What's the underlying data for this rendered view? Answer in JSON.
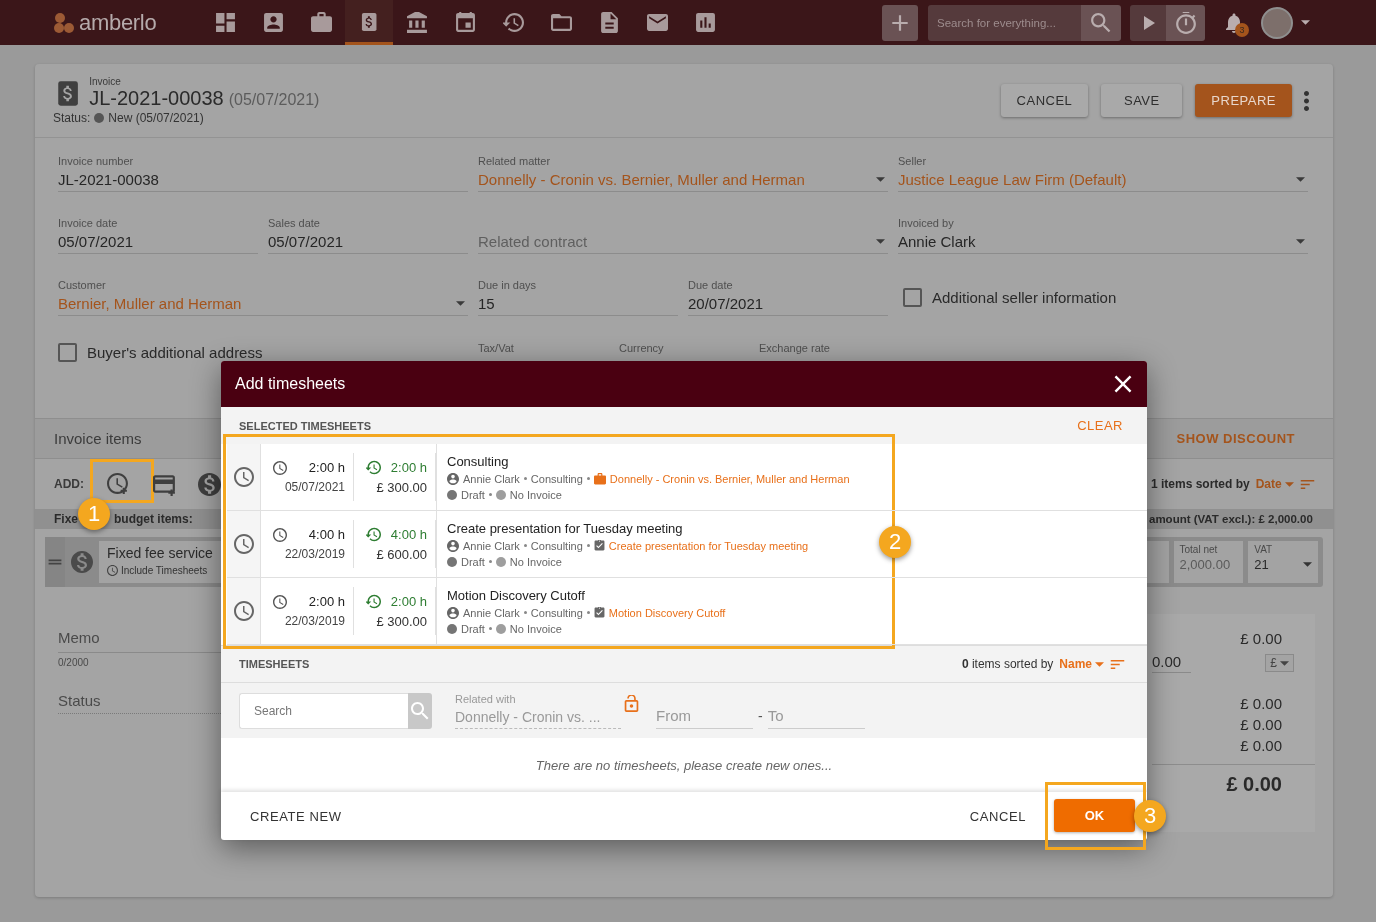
{
  "nav": {
    "logo": "amberlo",
    "items": [
      {
        "kind": "dashboard",
        "selected": false
      },
      {
        "kind": "contacts",
        "selected": false
      },
      {
        "kind": "matters",
        "selected": false
      },
      {
        "kind": "invoices",
        "selected": true
      },
      {
        "kind": "bank",
        "selected": false
      },
      {
        "kind": "calendar",
        "selected": false
      },
      {
        "kind": "timesheets",
        "selected": false
      },
      {
        "kind": "folder",
        "selected": false
      },
      {
        "kind": "documents",
        "selected": false
      },
      {
        "kind": "mail",
        "selected": false
      },
      {
        "kind": "reports",
        "selected": false
      }
    ],
    "search": {
      "placeholder": "Search for everything..."
    },
    "notifications": "3"
  },
  "invoice": {
    "type_label": "Invoice",
    "number": "JL-2021-00038",
    "date": "(05/07/2021)",
    "status_label": "Status:",
    "status": "New (05/07/2021)",
    "buttons": [
      {
        "label": "CANCEL",
        "kind": "default"
      },
      {
        "label": "SAVE",
        "kind": "default"
      },
      {
        "label": "PREPARE",
        "kind": "primary"
      }
    ]
  },
  "form": {
    "invoice_number": {
      "label": "Invoice number",
      "value": "JL-2021-00038"
    },
    "related_matter": {
      "label": "Related matter",
      "value": "Donnelly - Cronin vs. Bernier, Muller and Herman"
    },
    "seller": {
      "label": "Seller",
      "value": "Justice League Law Firm (Default)"
    },
    "invoice_date": {
      "label": "Invoice date",
      "value": "05/07/2021"
    },
    "sales_date": {
      "label": "Sales date",
      "value": "05/07/2021"
    },
    "related_contract": {
      "placeholder": "Related contract"
    },
    "invoiced_by": {
      "label": "Invoiced by",
      "value": "Annie Clark"
    },
    "customer": {
      "label": "Customer",
      "value": "Bernier, Muller and Herman"
    },
    "due_in_days": {
      "label": "Due in days",
      "value": "15"
    },
    "due_date": {
      "label": "Due date",
      "value": "20/07/2021"
    },
    "additional_seller_info": {
      "label": "Additional seller information",
      "checked": false
    },
    "buyers_address": {
      "label": "Buyer's additional address",
      "checked": false
    },
    "tax_vat": {
      "label": "Tax/Vat"
    },
    "currency": {
      "label": "Currency"
    },
    "exchange_rate": {
      "label": "Exchange rate"
    }
  },
  "items": {
    "title": "Invoice items",
    "show_discount": "SHOW DISCOUNT",
    "add_label": "ADD:",
    "sort_text": "1 items sorted by",
    "sort_field": "Date",
    "budget_label_parts": [
      "Fixe",
      "budget items:"
    ],
    "amount_text": "amount (VAT excl.): £ 2,000.00",
    "row": {
      "name": "Fixed fee service",
      "include": "Include Timesheets",
      "total_net_label": "Total net",
      "total_net": "2,000.00",
      "vat_label": "VAT",
      "vat": "21"
    },
    "memo": "Memo",
    "memo_count": "0/2000",
    "status": "Status",
    "totals": {
      "first": "£ 0.00",
      "discount": "0.00",
      "currency": "£",
      "lines": [
        "£ 0.00",
        "£ 0.00",
        "£ 0.00"
      ],
      "total": "£ 0.00"
    }
  },
  "dialog": {
    "title": "Add timesheets",
    "selected_heading": "SELECTED TIMESHEETS",
    "clear": "CLEAR",
    "selected": [
      {
        "duration": "2:00 h",
        "date": "05/07/2021",
        "billed": "2:00 h",
        "amount": "£ 300.00",
        "title": "Consulting",
        "user": "Annie Clark",
        "activity": "Consulting",
        "link": {
          "kind": "matter",
          "text": "Donnelly - Cronin vs. Bernier, Muller and Herman"
        },
        "statuses": [
          {
            "label": "Draft",
            "color": "#757575"
          },
          {
            "label": "No Invoice",
            "color": "#9e9e9e"
          }
        ]
      },
      {
        "duration": "4:00 h",
        "date": "22/03/2019",
        "billed": "4:00 h",
        "amount": "£ 600.00",
        "title": "Create presentation for Tuesday meeting",
        "user": "Annie Clark",
        "activity": "Consulting",
        "link": {
          "kind": "task",
          "text": "Create presentation for Tuesday meeting"
        },
        "statuses": [
          {
            "label": "Draft",
            "color": "#757575"
          },
          {
            "label": "No Invoice",
            "color": "#9e9e9e"
          }
        ]
      },
      {
        "duration": "2:00 h",
        "date": "22/03/2019",
        "billed": "2:00 h",
        "amount": "£ 300.00",
        "title": "Motion Discovery Cutoff",
        "user": "Annie Clark",
        "activity": "Consulting",
        "link": {
          "kind": "task",
          "text": "Motion Discovery Cutoff"
        },
        "statuses": [
          {
            "label": "Draft",
            "color": "#757575"
          },
          {
            "label": "No Invoice",
            "color": "#9e9e9e"
          }
        ]
      }
    ],
    "list_heading": "TIMESHEETS",
    "sort_text": "**0** items sorted by",
    "sort_field": "Name",
    "search": {
      "placeholder": "Search"
    },
    "related": {
      "label": "Related with",
      "value": "Donnelly - Cronin vs. ...",
      "disabled": true
    },
    "from": {
      "placeholder": "From"
    },
    "separator": "-",
    "to": {
      "placeholder": "To"
    },
    "empty": "There are no timesheets, please create new ones...",
    "create_new": "CREATE NEW",
    "cancel": "CANCEL",
    "ok": "OK"
  },
  "annotations": [
    {
      "label": "1"
    },
    {
      "label": "2"
    },
    {
      "label": "3"
    }
  ]
}
